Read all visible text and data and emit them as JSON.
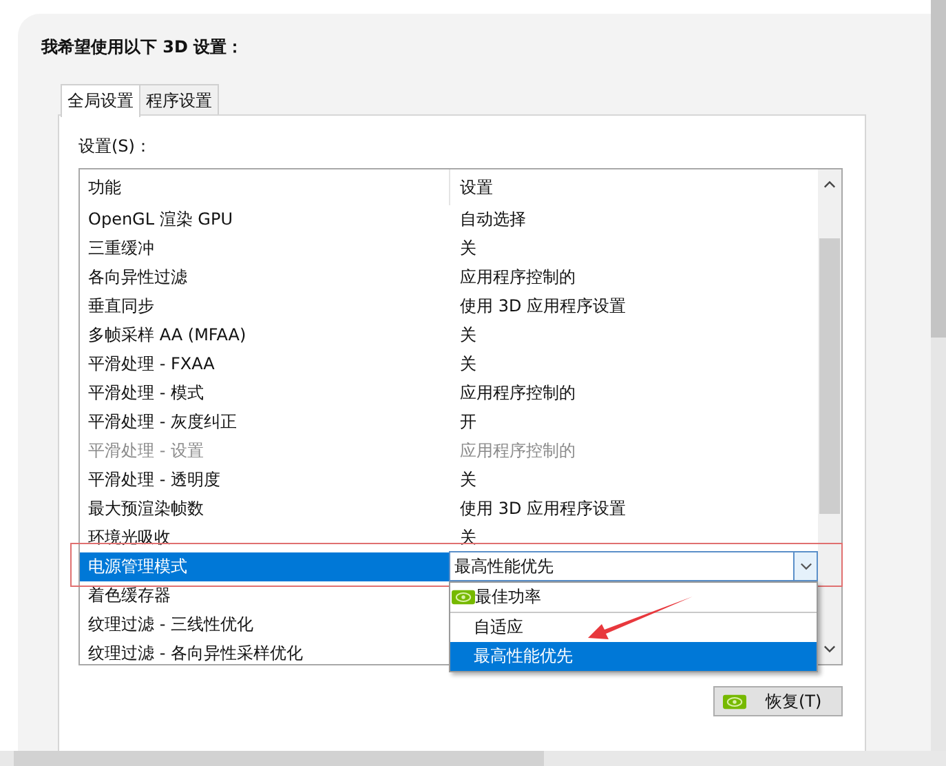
{
  "heading": "我希望使用以下 3D 设置：",
  "tabs": [
    {
      "label": "全局设置",
      "selected": true
    },
    {
      "label": "程序设置",
      "selected": false
    }
  ],
  "settings_label": "设置(S)：",
  "columns": [
    "功能",
    "设置"
  ],
  "rows": [
    {
      "feature": "OpenGL 渲染 GPU",
      "value": "自动选择",
      "disabled": false,
      "selected": false
    },
    {
      "feature": "三重缓冲",
      "value": "关",
      "disabled": false,
      "selected": false
    },
    {
      "feature": "各向异性过滤",
      "value": "应用程序控制的",
      "disabled": false,
      "selected": false
    },
    {
      "feature": "垂直同步",
      "value": "使用 3D 应用程序设置",
      "disabled": false,
      "selected": false
    },
    {
      "feature": "多帧采样 AA (MFAA)",
      "value": "关",
      "disabled": false,
      "selected": false
    },
    {
      "feature": "平滑处理 - FXAA",
      "value": "关",
      "disabled": false,
      "selected": false
    },
    {
      "feature": "平滑处理 - 模式",
      "value": "应用程序控制的",
      "disabled": false,
      "selected": false
    },
    {
      "feature": "平滑处理 - 灰度纠正",
      "value": "开",
      "disabled": false,
      "selected": false
    },
    {
      "feature": "平滑处理 - 设置",
      "value": "应用程序控制的",
      "disabled": true,
      "selected": false
    },
    {
      "feature": "平滑处理 - 透明度",
      "value": "关",
      "disabled": false,
      "selected": false
    },
    {
      "feature": "最大预渲染帧数",
      "value": "使用 3D 应用程序设置",
      "disabled": false,
      "selected": false
    },
    {
      "feature": "环境光吸收",
      "value": "关",
      "disabled": false,
      "selected": false
    },
    {
      "feature": "电源管理模式",
      "disabled": false,
      "selected": true
    },
    {
      "feature": "着色缓存器",
      "disabled": false,
      "selected": false
    },
    {
      "feature": "纹理过滤 - 三线性优化",
      "disabled": false,
      "selected": false
    },
    {
      "feature": "纹理过滤 - 各向异性采样优化",
      "disabled": false,
      "selected": false
    }
  ],
  "dropdown": {
    "value": "最高性能优先",
    "options": [
      {
        "label": "最佳功率",
        "kind": "recommended",
        "selected": false
      },
      {
        "label": "自适应",
        "kind": "plain",
        "selected": false
      },
      {
        "label": "最高性能优先",
        "kind": "plain",
        "selected": true
      }
    ]
  },
  "restore_button": "恢复(T)"
}
